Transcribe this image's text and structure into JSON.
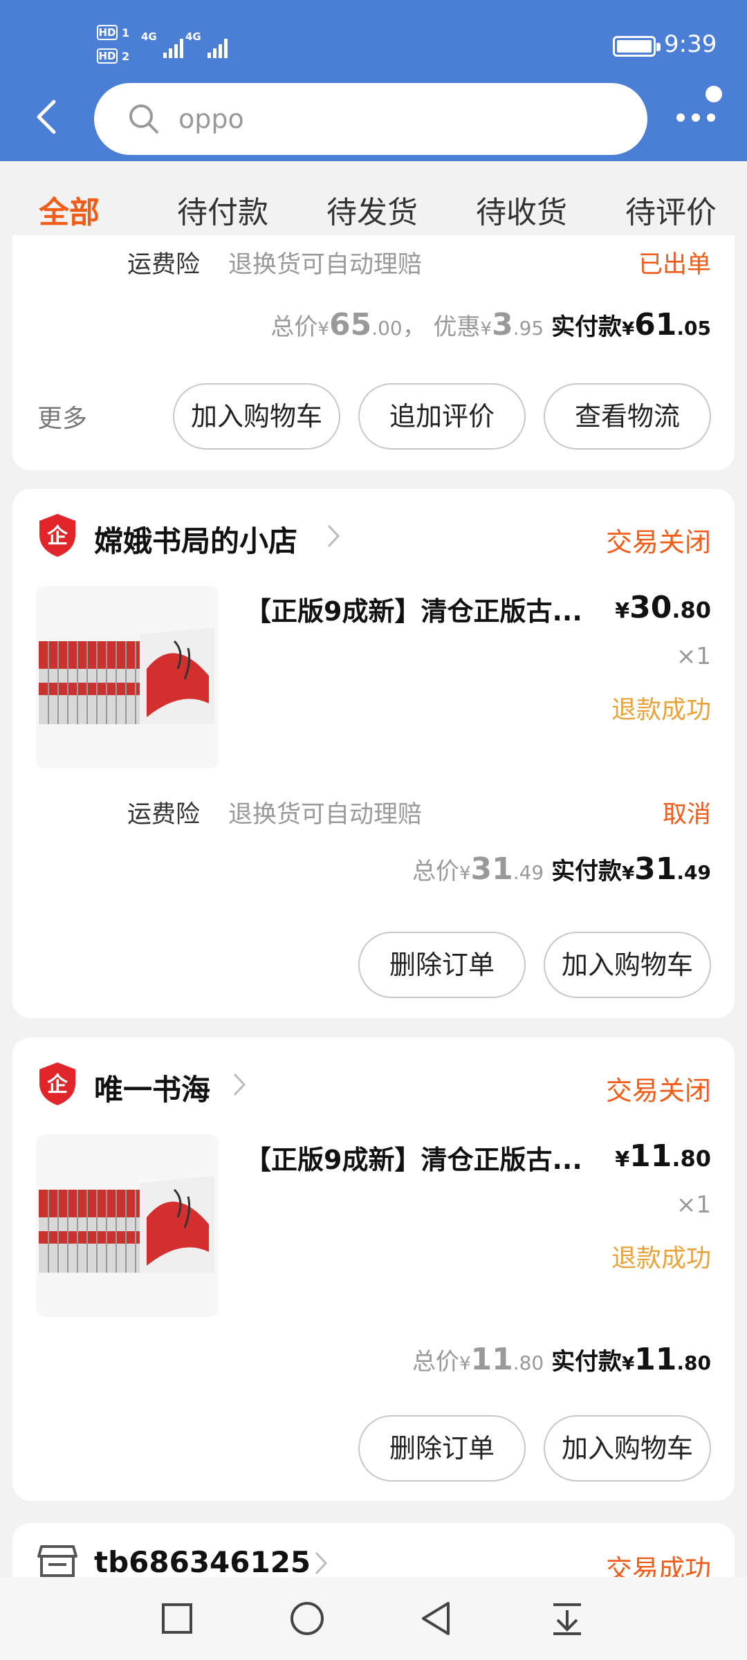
{
  "status_bar": {
    "hd1": "HD",
    "sim1": "1",
    "hd2": "HD",
    "sim2": "2",
    "net1": "4G",
    "net2": "4G",
    "time": "9:39"
  },
  "search": {
    "value": "oppo",
    "back_icon": "back-arrow-icon",
    "more_icon": "more-dots-icon"
  },
  "tabs": [
    {
      "label": "全部",
      "active": true
    },
    {
      "label": "待付款"
    },
    {
      "label": "待发货"
    },
    {
      "label": "待收货"
    },
    {
      "label": "待评价"
    }
  ],
  "orders": [
    {
      "insurance_label": "运费险",
      "insurance_desc": "退换货可自动理赔",
      "insurance_status": "已出单",
      "total_label": "总价",
      "currency": "¥",
      "total_int": "65",
      "total_dec": ".00",
      "sep": "，",
      "discount_label": "优惠",
      "discount_int": "3",
      "discount_dec": ".95",
      "paid_label": "实付款",
      "paid_int": "61",
      "paid_dec": ".05",
      "more_label": "更多",
      "buttons": [
        "加入购物车",
        "追加评价",
        "查看物流"
      ]
    },
    {
      "shop_name": "嫦娥书局的小店",
      "status": "交易关闭",
      "product_title": "【正版9成新】清仓正版古...",
      "currency": "¥",
      "price_int": "30",
      "price_dec": ".80",
      "qty": "×1",
      "refund": "退款成功",
      "insurance_label": "运费险",
      "insurance_desc": "退换货可自动理赔",
      "insurance_status": "取消",
      "total_label": "总价",
      "total_int": "31",
      "total_dec": ".49",
      "paid_label": "实付款",
      "paid_int": "31",
      "paid_dec": ".49",
      "buttons": [
        "删除订单",
        "加入购物车"
      ]
    },
    {
      "shop_name": "唯一书海",
      "status": "交易关闭",
      "product_title": "【正版9成新】清仓正版古...",
      "currency": "¥",
      "price_int": "11",
      "price_dec": ".80",
      "qty": "×1",
      "refund": "退款成功",
      "total_label": "总价",
      "total_int": "11",
      "total_dec": ".80",
      "paid_label": "实付款",
      "paid_int": "11",
      "paid_dec": ".80",
      "buttons": [
        "删除订单",
        "加入购物车"
      ]
    },
    {
      "shop_name": "tb686346125",
      "status": "交易成功"
    }
  ],
  "colors": {
    "header": "#4a7fd5",
    "accent": "#f25c19",
    "refund": "#e8a33a"
  },
  "nav_icons": [
    "recent-apps-icon",
    "home-icon",
    "back-icon",
    "notification-pull-icon"
  ]
}
